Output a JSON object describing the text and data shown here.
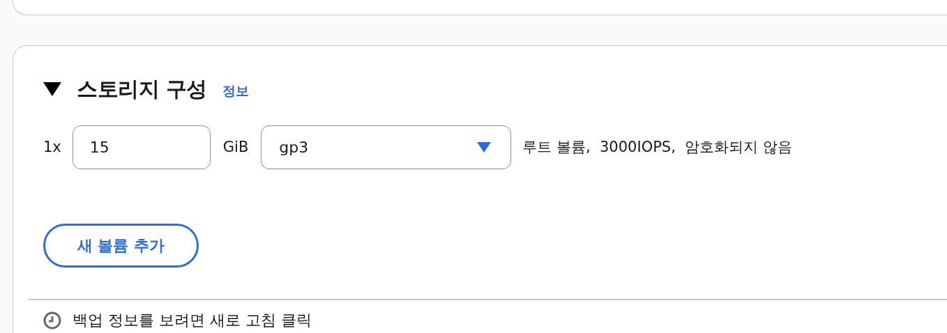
{
  "section": {
    "title": "스토리지 구성",
    "expanded": true,
    "info_link": "정보"
  },
  "volume": {
    "count": "1x",
    "size": "15",
    "unit": "GiB",
    "type": "gp3",
    "description": "루트 볼륨,  3000IOPS,  암호화되지 않음"
  },
  "add_button": "새 볼륨 추가",
  "backup_note": "백업 정보를 보려면 새로 고침 클릭"
}
